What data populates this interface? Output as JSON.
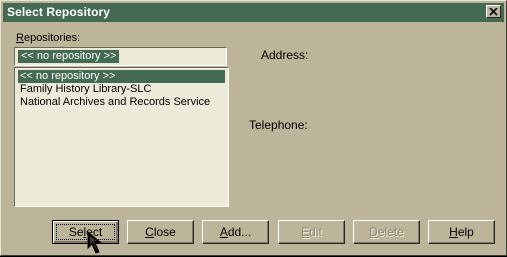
{
  "window": {
    "title": "Select Repository",
    "close_symbol": "✕"
  },
  "repositories": {
    "label": "Repositories:",
    "combo_value": "<< no repository >>",
    "items": [
      {
        "label": "<< no repository >>",
        "selected": true
      },
      {
        "label": "Family History Library-SLC",
        "selected": false
      },
      {
        "label": "National Archives and Records Service",
        "selected": false
      }
    ]
  },
  "details": {
    "address_label": "Address:",
    "telephone_label": "Telephone:"
  },
  "buttons": {
    "select": "Select",
    "close": "Close",
    "add": "Add...",
    "edit": "Edit",
    "delete": "Delete",
    "help": "Help"
  },
  "icons": {
    "close": "close-icon",
    "cursor": "mouse-pointer-icon"
  },
  "colors": {
    "dialog_bg": "#bcb59a",
    "titlebar_bg": "#456a54",
    "selection_bg": "#456a54",
    "field_bg": "#eeead9"
  }
}
